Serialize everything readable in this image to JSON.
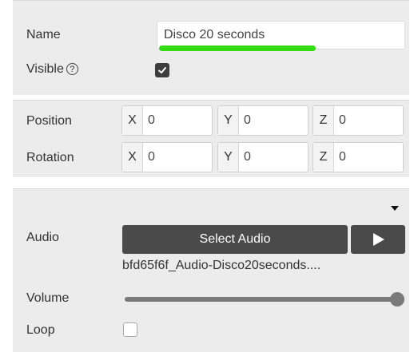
{
  "general": {
    "name_label": "Name",
    "name_value": "Disco 20 seconds",
    "visible_label": "Visible",
    "help_glyph": "?",
    "visible_checked": true
  },
  "transform": {
    "position_label": "Position",
    "rotation_label": "Rotation",
    "position": [
      {
        "axis": "X",
        "value": "0"
      },
      {
        "axis": "Y",
        "value": "0"
      },
      {
        "axis": "Z",
        "value": "0"
      }
    ],
    "rotation": [
      {
        "axis": "X",
        "value": "0"
      },
      {
        "axis": "Y",
        "value": "0"
      },
      {
        "axis": "Z",
        "value": "0"
      }
    ]
  },
  "audio": {
    "audio_label": "Audio",
    "select_button_label": "Select Audio",
    "play_icon": "play-icon",
    "file_name": "bfd65f6f_Audio-Disco20seconds....",
    "volume_label": "Volume",
    "volume_level": 1.0,
    "loop_label": "Loop",
    "loop_checked": false
  },
  "colors": {
    "panel_bg": "#ececec",
    "button_bg": "#4a4a4a",
    "highlight": "#33dd11"
  }
}
